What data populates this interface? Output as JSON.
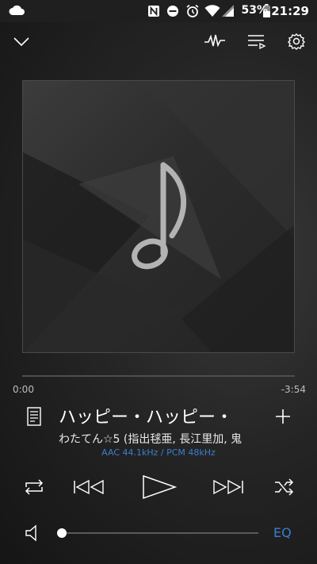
{
  "status_bar": {
    "battery_percent": "53%",
    "time": "21:29"
  },
  "player": {
    "elapsed": "0:00",
    "remaining": "-3:54",
    "progress": 0.0,
    "title": "ハッピー・ハッピー・",
    "artist": "わたてん☆5 (指出毬亜, 長江里加, 鬼",
    "format": "AAC 44.1kHz / PCM 48kHz",
    "volume": 0.0,
    "eq_label": "EQ"
  },
  "icons": {
    "cloud": "cloud-icon",
    "nfc": "nfc-icon",
    "dnd": "do-not-disturb-icon",
    "alarm": "alarm-icon",
    "wifi": "wifi-icon",
    "signal": "signal-icon",
    "battery": "battery-icon",
    "collapse": "chevron-down-icon",
    "visualizer": "waveform-icon",
    "queue": "playlist-icon",
    "settings": "gear-icon",
    "lyrics": "lyrics-icon",
    "add": "plus-icon",
    "repeat": "repeat-icon",
    "prev": "skip-previous-icon",
    "play": "play-icon",
    "next": "skip-next-icon",
    "shuffle": "shuffle-icon",
    "volume": "volume-icon",
    "art": "music-note-icon"
  },
  "colors": {
    "accent": "#3a7fd0",
    "background": "#1f1f1f"
  }
}
